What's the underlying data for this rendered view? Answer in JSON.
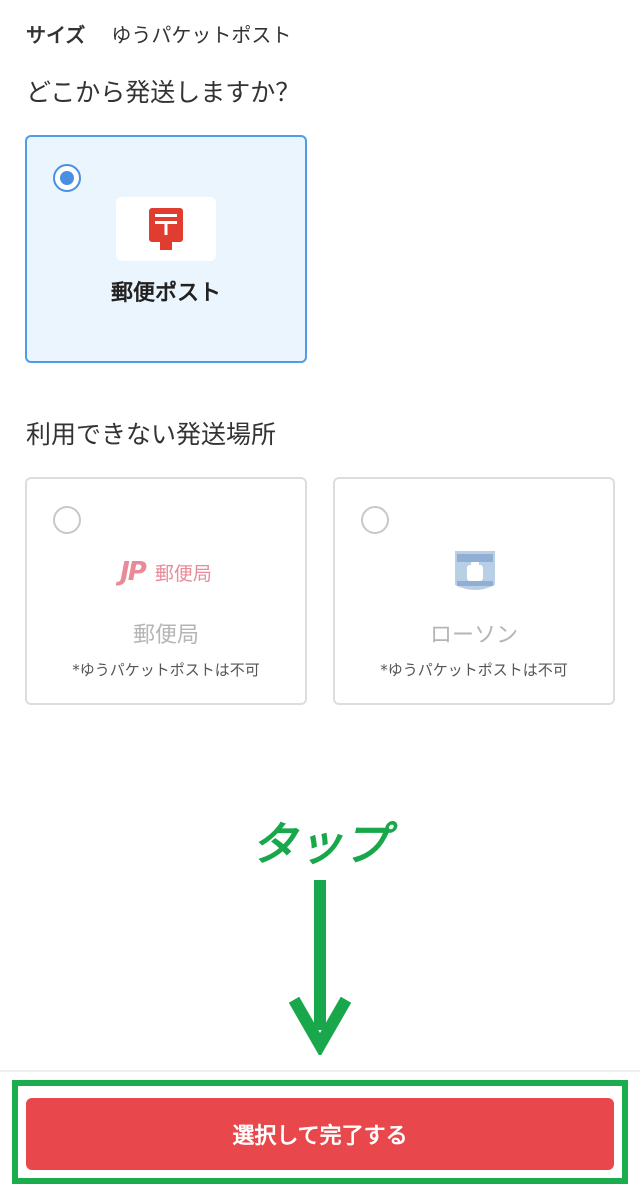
{
  "size": {
    "label": "サイズ",
    "value": "ゆうパケットポスト"
  },
  "question": "どこから発送しますか？",
  "available": [
    {
      "label": "郵便ポスト",
      "selected": true,
      "icon": "post-box-icon"
    }
  ],
  "unavailable_title": "利用できない発送場所",
  "unavailable": [
    {
      "label": "郵便局",
      "note": "*ゆうパケットポストは不可",
      "icon": "japan-post-logo",
      "logo_mark": "JP",
      "logo_text": "郵便局"
    },
    {
      "label": "ローソン",
      "note": "*ゆうパケットポストは不可",
      "icon": "lawson-logo"
    }
  ],
  "annotation": "タップ",
  "submit_label": "選択して完了する",
  "colors": {
    "accent_red": "#e8474b",
    "selected_border": "#4e9de6",
    "selected_bg": "#eaf5fd",
    "annotation_green": "#1aac4d"
  }
}
